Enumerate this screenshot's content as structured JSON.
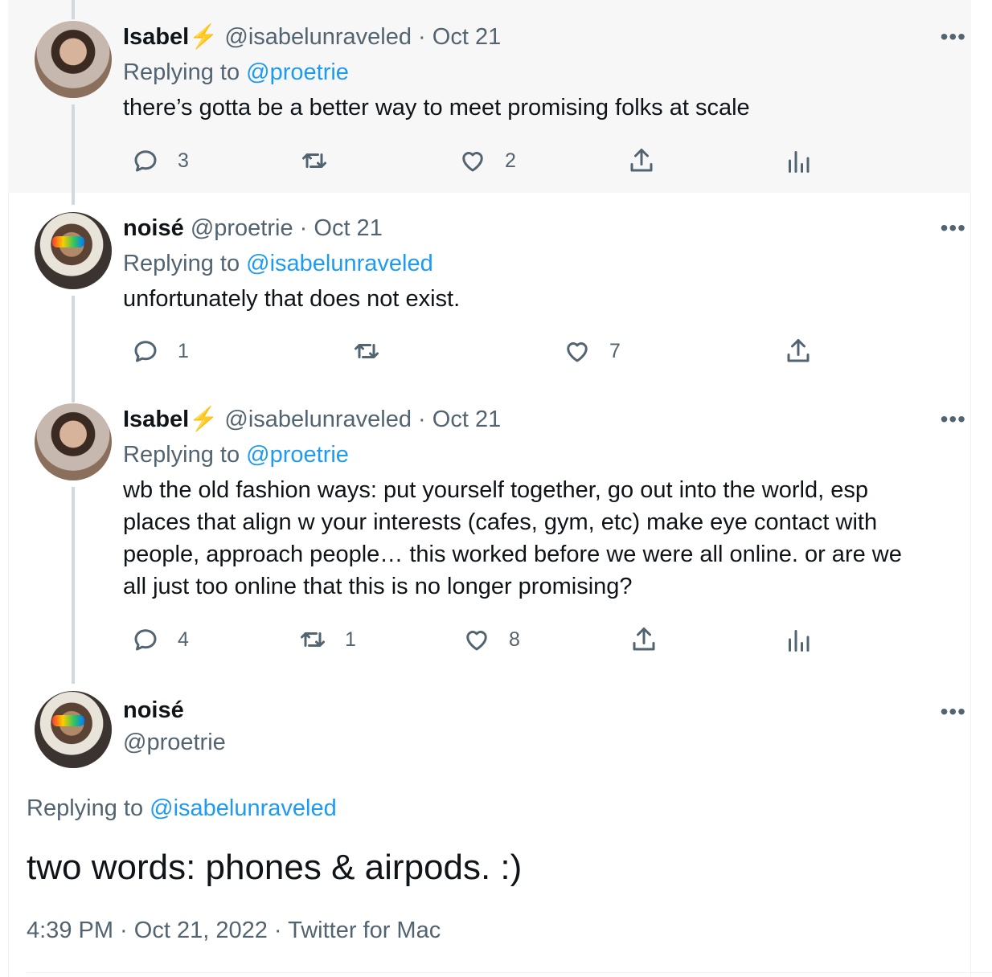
{
  "tweets": [
    {
      "name": "Isabel",
      "emoji": "⚡",
      "handle": "@isabelunraveled",
      "date": "Oct 21",
      "replying_label": "Replying to",
      "replying_to": "@proetrie",
      "text": "there’s gotta be a better way to meet promising folks at scale",
      "replies": "3",
      "retweets": "",
      "likes": "2",
      "more": "•••"
    },
    {
      "name": "noisé",
      "handle": "@proetrie",
      "date": "Oct 21",
      "replying_label": "Replying to",
      "replying_to": "@isabelunraveled",
      "text": "unfortunately that does not exist.",
      "replies": "1",
      "retweets": "",
      "likes": "7",
      "more": "•••"
    },
    {
      "name": "Isabel",
      "emoji": "⚡",
      "handle": "@isabelunraveled",
      "date": "Oct 21",
      "replying_label": "Replying to",
      "replying_to": "@proetrie",
      "text_lines": [
        "wb the old fashion ways: put yourself together, go out into the world, esp",
        "places that align w your interests (cafes, gym, etc) make eye contact with",
        "people, approach people… this worked before we were all online. or are we",
        "all just too online that this is no longer promising?"
      ],
      "replies": "4",
      "retweets": "1",
      "likes": "8",
      "more": "•••"
    }
  ],
  "main": {
    "name": "noisé",
    "handle": "@proetrie",
    "replying_label": "Replying to",
    "replying_to": "@isabelunraveled",
    "text": "two words: phones & airpods. :)",
    "timestamp": "4:39 PM · Oct 21, 2022 · Twitter for Mac",
    "more": "•••"
  },
  "icons": [
    "reply-icon",
    "retweet-icon",
    "like-icon",
    "share-icon",
    "analytics-icon"
  ],
  "colors": {
    "link": "#1d9bf0",
    "muted": "#536471",
    "text": "#0f1419",
    "highlight_bg": "#f7f7f7"
  }
}
